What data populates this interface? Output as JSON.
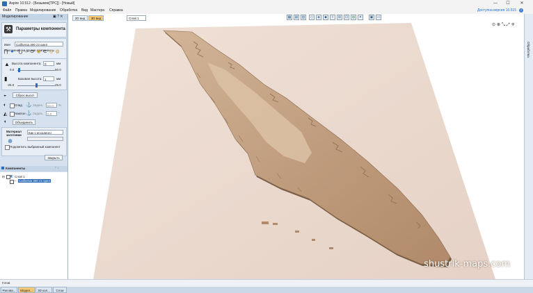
{
  "window": {
    "title": "Aspire 10.512 - [Безымян[TPC]] - [Новый]",
    "minimize": "—",
    "maximize": "☐",
    "close": "✕"
  },
  "menu": {
    "items": [
      "Файл",
      "Правка",
      "Моделирование",
      "Обработка",
      "Вид",
      "Мастера",
      "Справка"
    ],
    "upgrade": "Доступна версия 10.515"
  },
  "left_panel": {
    "header": "Моделирование",
    "header_icons": "▣ ? ✕",
    "params_title": "Параметры компонента",
    "name_label": "Имя",
    "name_value": "California 300 z3 opeл",
    "overlay_label": "Наложение на другие компоненты",
    "height_label": "Высота компонента:",
    "height_value": "0",
    "height_unit": "мм",
    "height_min": "0.0",
    "height_max": "50.0",
    "base_label": "Базовая высота:",
    "base_value": "1",
    "base_unit": "мм",
    "base_min": "-25.0",
    "base_max": "25.0",
    "reset_button": "Сброс высот",
    "fade_label": "Спад",
    "fade_set_label": "Задать",
    "fade_value": "50.0",
    "fade_unit": "%",
    "tilt_label": "Наклон",
    "tilt_set_label": "Задать",
    "tilt_value": "0.0",
    "tilt_unit": "°",
    "merge_button": "Объединить",
    "material_label": "Материал заготовки",
    "material_value": "Как у исходного",
    "highlight_label": "Подсветить выбранный компонент",
    "close_button": "Закрыть",
    "components_title": "Компоненты",
    "tree": {
      "layer": "Слой 1",
      "item": "California 300 z3 opeл"
    },
    "bottom_tabs": [
      "Рисова...",
      "Модел...",
      "3D кол...",
      "Слои"
    ]
  },
  "viewport": {
    "tab_2d": "2D вид",
    "tab_3d": "3D вид",
    "layer": "Слой 1",
    "watermark": "shustrik-maps.com"
  },
  "right_strip": {
    "label": "Обработка"
  },
  "status": {
    "text": "Готов"
  },
  "colors": {
    "accent": "#2b6cb8",
    "board": "#ecdcd0",
    "relief": "#c7a788"
  }
}
